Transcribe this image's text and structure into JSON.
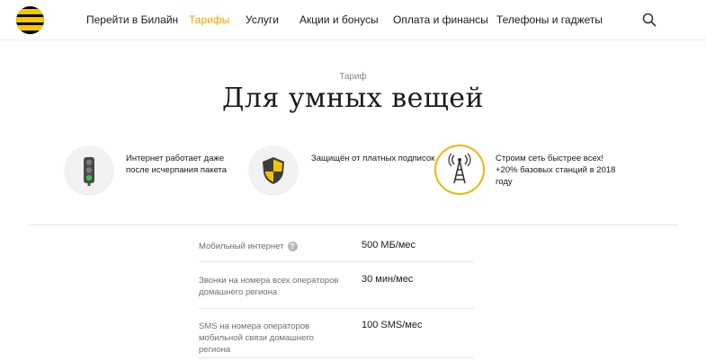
{
  "header": {
    "logo": "beeline-logo",
    "nav": [
      {
        "label": "Перейти в Билайн"
      },
      {
        "label": "Тарифы",
        "active": true
      },
      {
        "label": "Услуги"
      },
      {
        "label": "Акции и бонусы"
      },
      {
        "label": "Оплата и финансы"
      },
      {
        "label": "Телефоны и гаджеты"
      }
    ],
    "search_icon": "search-icon"
  },
  "hero": {
    "kicker": "Тариф",
    "title": "Для умных вещей"
  },
  "features": [
    {
      "icon": "traffic-light-icon",
      "text": "Интернет работает даже после исчерпания пакета"
    },
    {
      "icon": "shield-icon",
      "text": "Защищён от платных подписок"
    },
    {
      "icon": "cell-tower-icon",
      "text": "Строим сеть быстрее всех! +20% базовых станций в 2018 году"
    }
  ],
  "specs": [
    {
      "label": "Мобильный интернет",
      "info": "?",
      "value": "500 МБ/мес"
    },
    {
      "label": "Звонки на номера всех операторов домашнего региона",
      "value": "30 мин/мес"
    },
    {
      "label": "SMS на номера операторов мобильной связи домашнего региона",
      "value": "100 SMS/мес"
    }
  ],
  "colors": {
    "accent": "#f5b400",
    "brand_yellow": "#f6c600",
    "active_nav": "#f0a300"
  }
}
